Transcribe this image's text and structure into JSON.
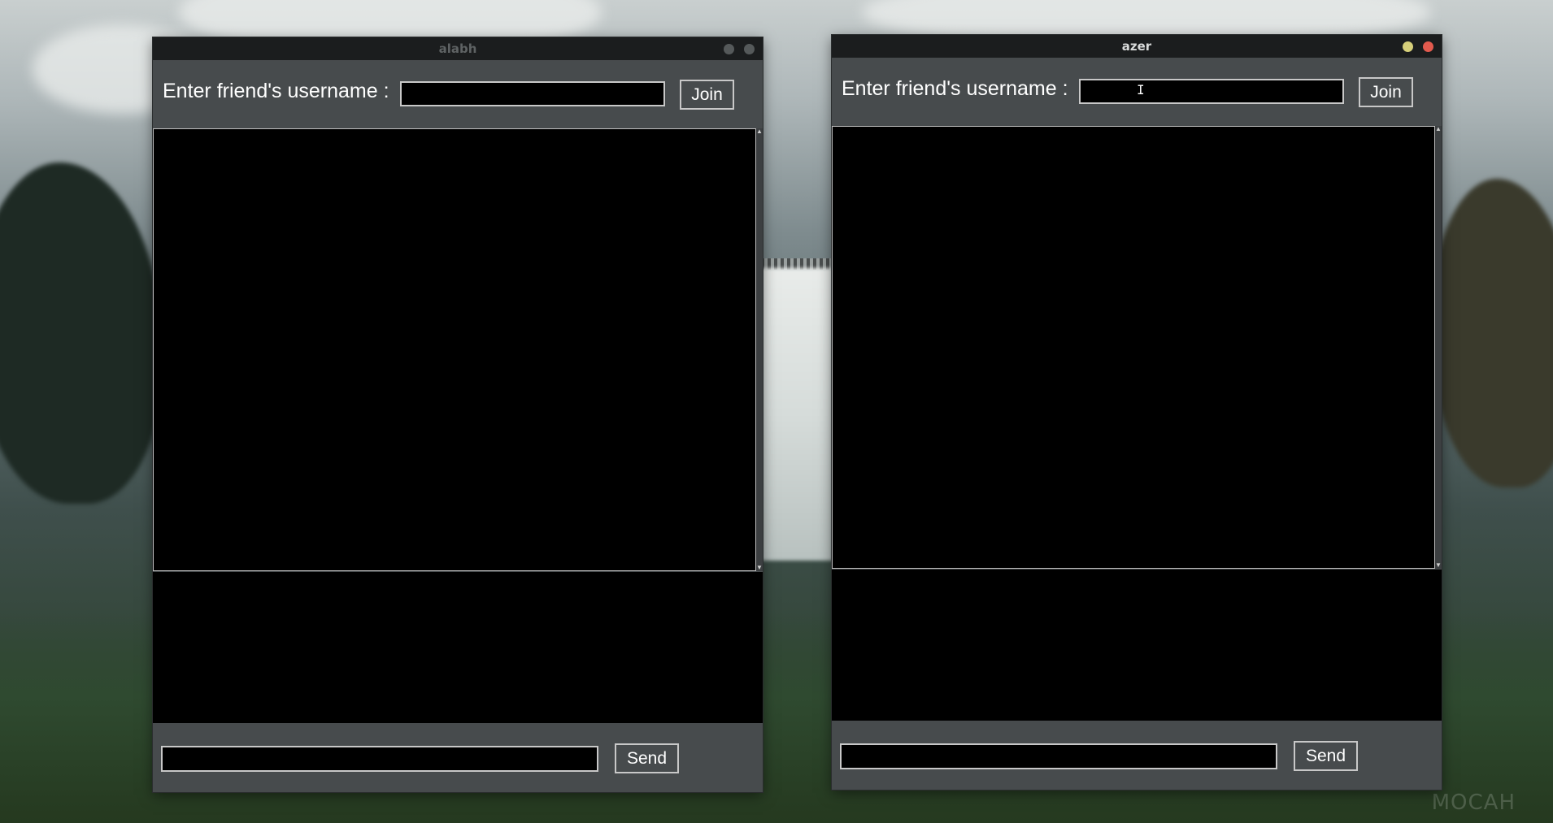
{
  "desktop": {
    "watermark": "MOCAH"
  },
  "windows": [
    {
      "title": "alabh",
      "focused": false,
      "username_label": "Enter friend's username :",
      "username_value": "",
      "join_label": "Join",
      "message_value": "",
      "send_label": "Send"
    },
    {
      "title": "azer",
      "focused": true,
      "username_label": "Enter friend's username :",
      "username_value": "",
      "join_label": "Join",
      "message_value": "",
      "send_label": "Send"
    }
  ],
  "icons": {
    "minimize": "minimize-icon",
    "close": "close-icon",
    "text_cursor": "i-beam-cursor-icon"
  },
  "colors": {
    "window_bg": "#474b4d",
    "titlebar_bg": "#1b1d1e",
    "focused_minimize": "#d6cf7a",
    "focused_close": "#e25a4e",
    "unfocused_button": "#55595a"
  }
}
